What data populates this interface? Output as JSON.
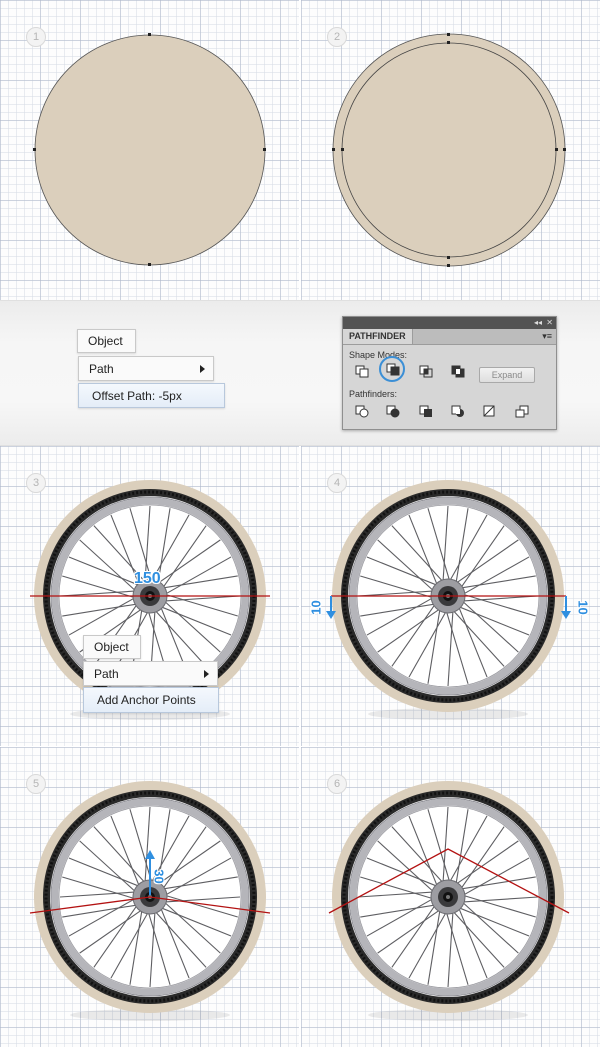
{
  "steps": [
    "1",
    "2",
    "3",
    "4",
    "5",
    "6"
  ],
  "menu_a": {
    "object": "Object",
    "path": "Path",
    "offset": "Offset Path: -5px"
  },
  "menu_b": {
    "object": "Object",
    "path": "Path",
    "add": "Add Anchor Points"
  },
  "pathfinder": {
    "title": "PATHFINDER",
    "collapse_glyph": "◂◂",
    "close_glyph": "✕",
    "menu_glyph": "▾≡",
    "shape_modes_label": "Shape Modes:",
    "pathfinders_label": "Pathfinders:",
    "expand_label": "Expand"
  },
  "measurements": {
    "m150": "150",
    "m10_left": "10",
    "m10_right": "10",
    "m30": "30"
  },
  "colors": {
    "fill": "#dbcfbc",
    "tire": "#2a2a2a",
    "rim": "#b5b5ba",
    "guide": "#b31212",
    "accent": "#2f8fe0"
  }
}
